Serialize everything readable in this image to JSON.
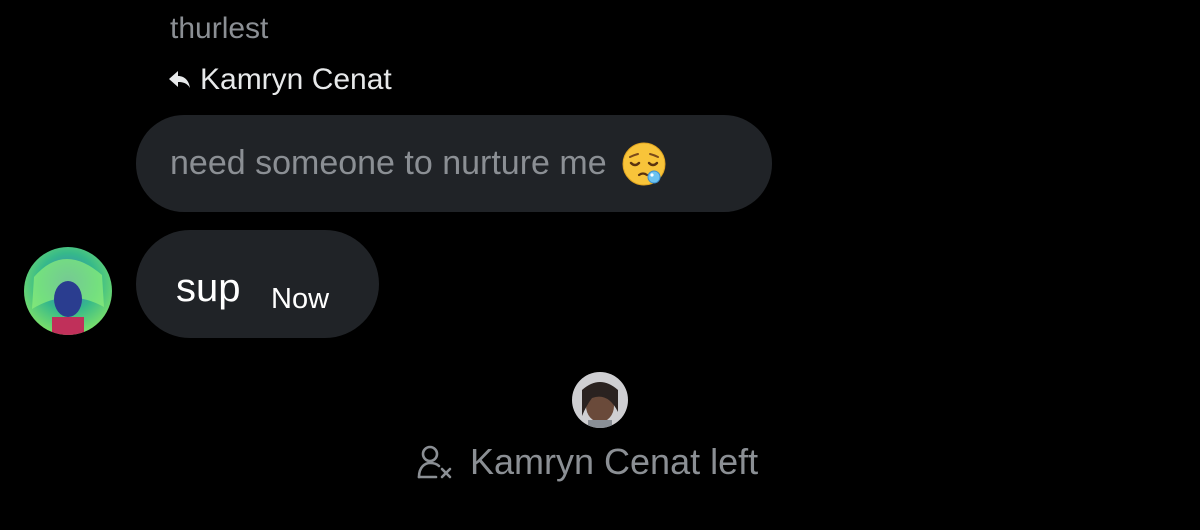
{
  "conversation": {
    "sender_name": "thurlest",
    "reply_to": {
      "icon": "reply-arrow-icon",
      "name": "Kamryn Cenat"
    },
    "quoted_message": {
      "text": "need someone to nurture me",
      "emoji": "sleepy-face-emoji"
    },
    "message": {
      "text": "sup",
      "timestamp": "Now"
    },
    "system_event": {
      "icon": "user-removed-icon",
      "text": "Kamryn Cenat left"
    }
  },
  "colors": {
    "background": "#000000",
    "bubble": "#202327",
    "muted_text": "#8b8f94",
    "primary_text": "#e7e9ea"
  }
}
